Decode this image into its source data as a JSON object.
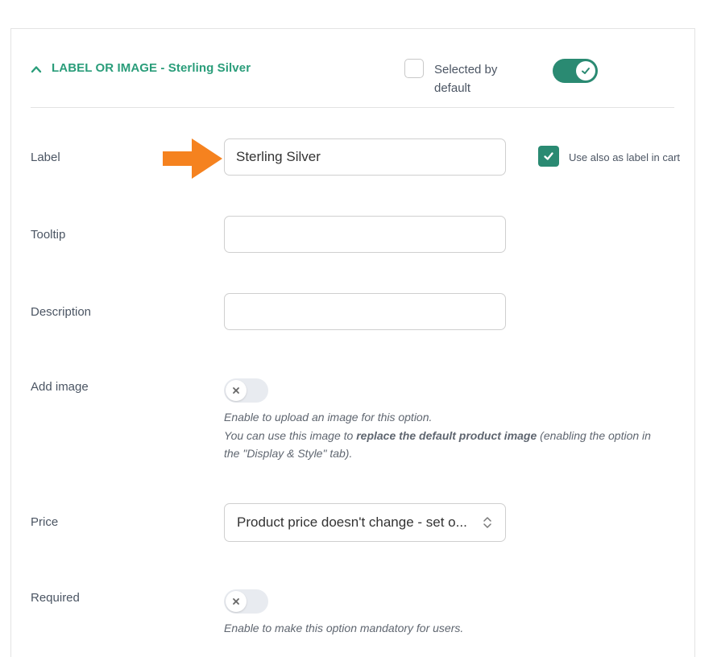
{
  "option_header": {
    "title": "LABEL OR IMAGE - Sterling Silver",
    "selected_by_default": {
      "label_line1": "Selected by",
      "label_line2": "default",
      "checked": false
    },
    "enabled": true
  },
  "fields": {
    "label": {
      "label": "Label",
      "value": "Sterling Silver",
      "use_in_cart_label": "Use also as label in cart",
      "use_in_cart_checked": true
    },
    "tooltip": {
      "label": "Tooltip",
      "value": ""
    },
    "description": {
      "label": "Description",
      "value": ""
    },
    "add_image": {
      "label": "Add image",
      "enabled": false,
      "help_line1": "Enable to upload an image for this option.",
      "help_line2_pre": "You can use this image to ",
      "help_line2_bold": "replace the default product image",
      "help_line2_post": " (enabling the option in",
      "help_line3": "the \"Display & Style\" tab)."
    },
    "price": {
      "label": "Price",
      "selected": "Product price doesn't change - set o..."
    },
    "required": {
      "label": "Required",
      "enabled": false,
      "help": "Enable to make this option mandatory for users."
    }
  },
  "colors": {
    "accent": "#2a8a72",
    "title": "#2a9d7a",
    "arrow": "#f5821f"
  },
  "icons": {
    "collapse": "chevron-up-icon",
    "pointer": "arrow-right-icon"
  }
}
